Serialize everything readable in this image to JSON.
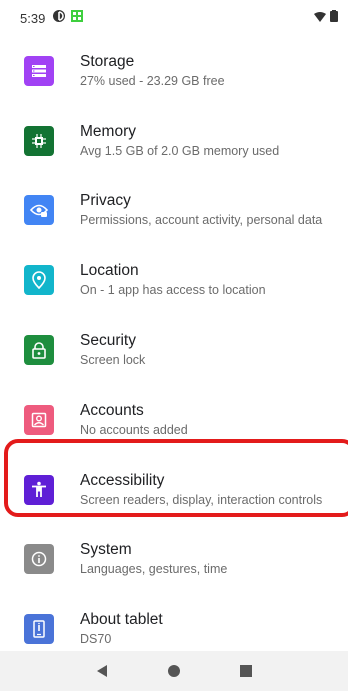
{
  "status_bar": {
    "time": "5:39"
  },
  "settings": {
    "items": [
      {
        "title": "Storage",
        "subtitle": "27% used - 23.29 GB free",
        "color": "#a142f4",
        "icon": "storage-icon"
      },
      {
        "title": "Memory",
        "subtitle": "Avg 1.5 GB of 2.0 GB memory used",
        "color": "#137333",
        "icon": "memory-chip-icon"
      },
      {
        "title": "Privacy",
        "subtitle": "Permissions, account activity, personal data",
        "color": "#4285f4",
        "icon": "privacy-eye-icon"
      },
      {
        "title": "Location",
        "subtitle": "On - 1 app has access to location",
        "color": "#12b5cb",
        "icon": "location-pin-icon"
      },
      {
        "title": "Security",
        "subtitle": "Screen lock",
        "color": "#1e8e3e",
        "icon": "lock-icon"
      },
      {
        "title": "Accounts",
        "subtitle": "No accounts added",
        "color": "#ee5b7e",
        "icon": "account-icon"
      },
      {
        "title": "Accessibility",
        "subtitle": "Screen readers, display, interaction controls",
        "color": "#5f1fd6",
        "icon": "accessibility-icon"
      },
      {
        "title": "System",
        "subtitle": "Languages, gestures, time",
        "color": "#8a8a8a",
        "icon": "info-icon"
      },
      {
        "title": "About tablet",
        "subtitle": "DS70",
        "color": "#4a73d8",
        "icon": "tablet-icon"
      }
    ]
  },
  "nav_bar": {
    "back": "back-icon",
    "home": "home-icon",
    "recents": "recents-icon"
  },
  "highlight_color": "#e31b1b"
}
